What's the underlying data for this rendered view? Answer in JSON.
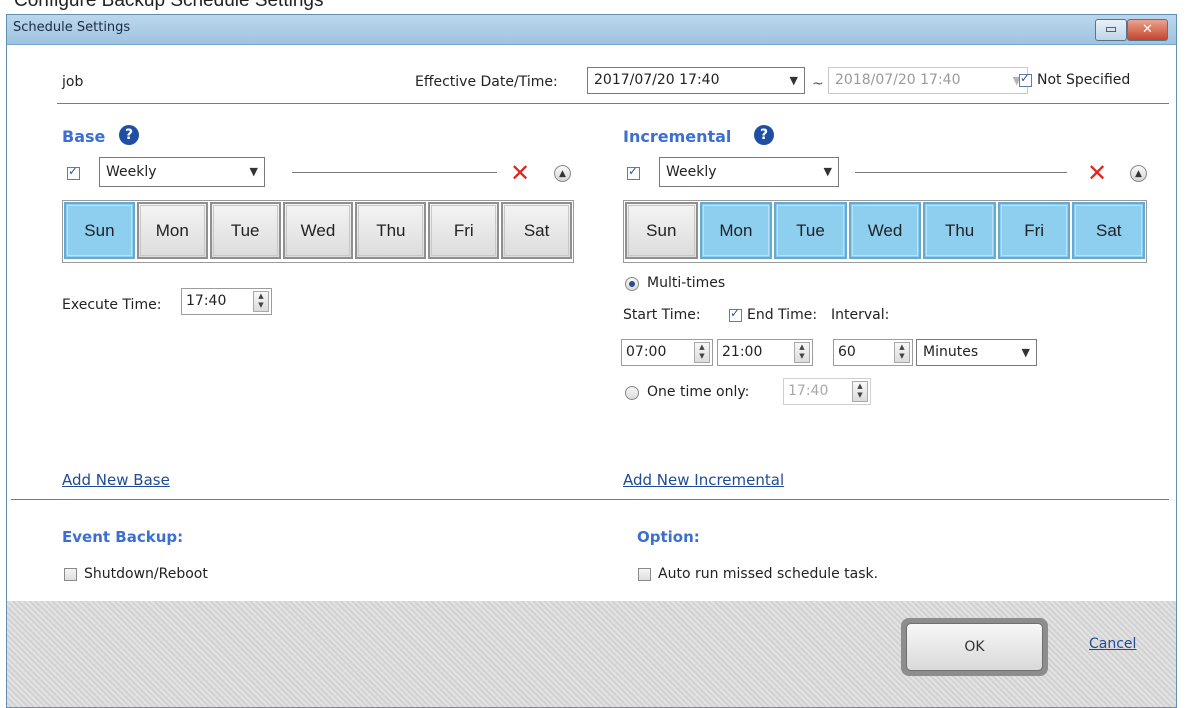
{
  "caption": "Configure Backup Schedule Settings",
  "window": {
    "title": "Schedule Settings",
    "restore_glyph": "▭",
    "close_glyph": "✕"
  },
  "job": {
    "label": "job",
    "effective_label": "Effective Date/Time:",
    "start_value": "2017/07/20 17:40",
    "tilde": "~",
    "end_value": "2018/07/20 17:40",
    "not_specified_label": "Not Specified",
    "not_specified_checked": true
  },
  "base": {
    "heading": "Base",
    "help_glyph": "?",
    "enabled": true,
    "frequency": "Weekly",
    "days": [
      {
        "label": "Sun",
        "on": true
      },
      {
        "label": "Mon",
        "on": false
      },
      {
        "label": "Tue",
        "on": false
      },
      {
        "label": "Wed",
        "on": false
      },
      {
        "label": "Thu",
        "on": false
      },
      {
        "label": "Fri",
        "on": false
      },
      {
        "label": "Sat",
        "on": false
      }
    ],
    "execute_time_label": "Execute Time:",
    "execute_time": "17:40",
    "add_link": "Add New Base"
  },
  "incremental": {
    "heading": "Incremental",
    "help_glyph": "?",
    "enabled": true,
    "frequency": "Weekly",
    "days": [
      {
        "label": "Sun",
        "on": false
      },
      {
        "label": "Mon",
        "on": true
      },
      {
        "label": "Tue",
        "on": true
      },
      {
        "label": "Wed",
        "on": true
      },
      {
        "label": "Thu",
        "on": true
      },
      {
        "label": "Fri",
        "on": true
      },
      {
        "label": "Sat",
        "on": true
      }
    ],
    "multi_times_label": "Multi-times",
    "start_time_label": "Start Time:",
    "end_time_label": "End Time:",
    "interval_label": "Interval:",
    "start_time": "07:00",
    "end_time": "21:00",
    "interval": "60",
    "interval_unit": "Minutes",
    "one_time_label": "One time only:",
    "one_time_value": "17:40",
    "add_link": "Add New Incremental"
  },
  "event_backup": {
    "heading": "Event Backup:",
    "shutdown_label": "Shutdown/Reboot"
  },
  "option": {
    "heading": "Option:",
    "auto_run_label": "Auto run missed schedule task."
  },
  "buttons": {
    "ok": "OK",
    "cancel": "Cancel"
  },
  "icons": {
    "delete": "x-icon",
    "collapse": "chevron-up-icon",
    "help": "help-icon"
  },
  "colors": {
    "heading": "#3c6fd1",
    "day_selected": "#8ecff0",
    "delete_icon": "#e0261e",
    "title_bar": "#a9cbe5"
  }
}
